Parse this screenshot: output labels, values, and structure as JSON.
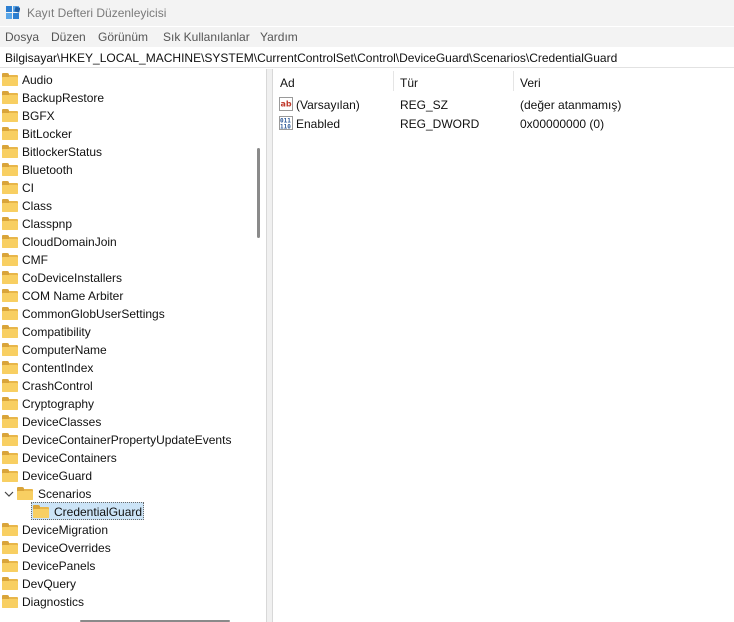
{
  "window": {
    "title": "Kayıt Defteri Düzenleyicisi"
  },
  "menu": [
    "Dosya",
    "Düzen",
    "Görünüm",
    "Sık Kullanılanlar",
    "Yardım"
  ],
  "address": "Bilgisayar\\HKEY_LOCAL_MACHINE\\SYSTEM\\CurrentControlSet\\Control\\DeviceGuard\\Scenarios\\CredentialGuard",
  "tree": {
    "items": [
      {
        "label": "Audio"
      },
      {
        "label": "BackupRestore"
      },
      {
        "label": "BGFX"
      },
      {
        "label": "BitLocker"
      },
      {
        "label": "BitlockerStatus"
      },
      {
        "label": "Bluetooth"
      },
      {
        "label": "CI"
      },
      {
        "label": "Class"
      },
      {
        "label": "Classpnp"
      },
      {
        "label": "CloudDomainJoin"
      },
      {
        "label": "CMF"
      },
      {
        "label": "CoDeviceInstallers"
      },
      {
        "label": "COM Name Arbiter"
      },
      {
        "label": "CommonGlobUserSettings"
      },
      {
        "label": "Compatibility"
      },
      {
        "label": "ComputerName"
      },
      {
        "label": "ContentIndex"
      },
      {
        "label": "CrashControl"
      },
      {
        "label": "Cryptography"
      },
      {
        "label": "DeviceClasses"
      },
      {
        "label": "DeviceContainerPropertyUpdateEvents"
      },
      {
        "label": "DeviceContainers"
      },
      {
        "label": "DeviceGuard"
      },
      {
        "label": "Scenarios"
      },
      {
        "label": "CredentialGuard"
      },
      {
        "label": "DeviceMigration"
      },
      {
        "label": "DeviceOverrides"
      },
      {
        "label": "DevicePanels"
      },
      {
        "label": "DevQuery"
      },
      {
        "label": "Diagnostics"
      }
    ],
    "selected": "CredentialGuard"
  },
  "list": {
    "columns": [
      "Ad",
      "Tür",
      "Veri"
    ],
    "rows": [
      {
        "name": "(Varsayılan)",
        "type": "REG_SZ",
        "data": "(değer atanmamış)",
        "icon": "string-value-icon"
      },
      {
        "name": "Enabled",
        "type": "REG_DWORD",
        "data": "0x00000000 (0)",
        "icon": "binary-value-icon"
      }
    ]
  },
  "colors": {
    "folder": "#f8cf62",
    "selection": "#cce4f7",
    "ab_icon": "#c0392b",
    "binary_icon": "#2b5797"
  }
}
